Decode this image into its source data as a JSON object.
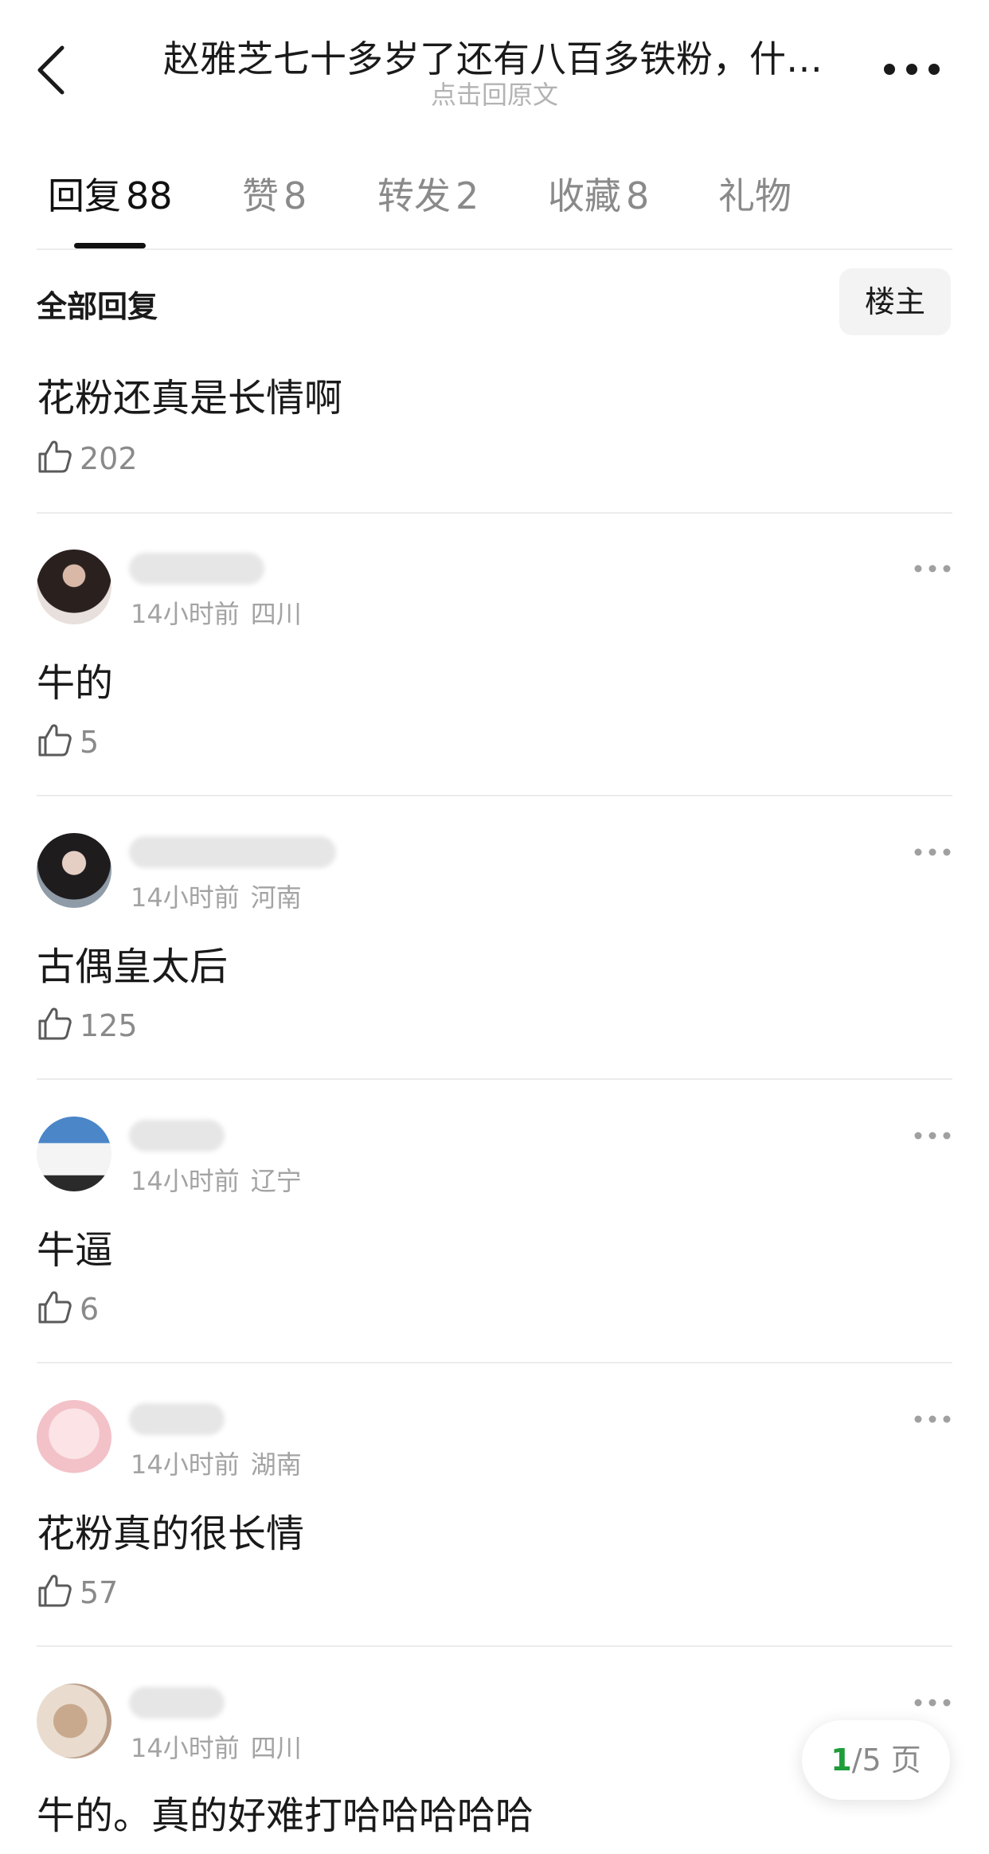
{
  "header": {
    "title": "赵雅芝七十多岁了还有八百多铁粉，什…",
    "subtitle": "点击回原文"
  },
  "tabs": [
    {
      "label": "回复",
      "count": "88"
    },
    {
      "label": "赞",
      "count": "8"
    },
    {
      "label": "转发",
      "count": "2"
    },
    {
      "label": "收藏",
      "count": "8"
    },
    {
      "label": "礼物",
      "count": ""
    }
  ],
  "section": {
    "label": "全部回复",
    "filter_label": "楼主"
  },
  "main_post": {
    "text": "花粉还真是长情啊",
    "likes": "202"
  },
  "comments": [
    {
      "time": "14小时前",
      "location": "四川",
      "text": "牛的",
      "likes": "5"
    },
    {
      "time": "14小时前",
      "location": "河南",
      "text": "古偶皇太后",
      "likes": "125"
    },
    {
      "time": "14小时前",
      "location": "辽宁",
      "text": "牛逼",
      "likes": "6"
    },
    {
      "time": "14小时前",
      "location": "湖南",
      "text": "花粉真的很长情",
      "likes": "57"
    },
    {
      "time": "14小时前",
      "location": "四川",
      "text": "牛的。真的好难打哈哈哈哈哈",
      "likes": ""
    }
  ],
  "pager": {
    "current": "1",
    "rest": "/5 页"
  },
  "icons": {
    "back": "chevron-left-icon",
    "more": "more-horizontal-icon",
    "like": "thumbs-up-icon"
  }
}
